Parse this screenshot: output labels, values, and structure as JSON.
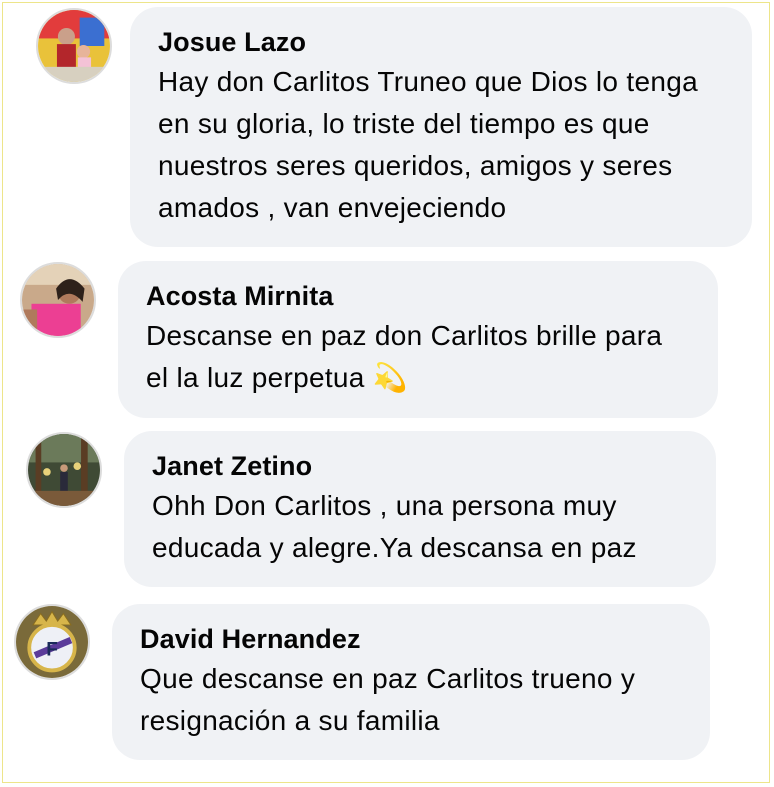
{
  "colors": {
    "bubble": "#f0f2f5",
    "text": "#050505",
    "frame": "#ede58a"
  },
  "comments": [
    {
      "author": "Josue Lazo",
      "text": "Hay don Carlitos Truneo que Dios lo tenga en su gloria, lo triste del tiempo es que nuestros seres queridos, amigos y seres amados , van envejeciendo",
      "avatar_icon": "profile-photo"
    },
    {
      "author": "Acosta Mirnita",
      "text": "Descanse en paz don Carlitos    brille para el la luz perpetua 💫",
      "avatar_icon": "profile-photo"
    },
    {
      "author": "Janet Zetino",
      "text": "Ohh Don Carlitos , una persona muy educada y alegre.Ya descansa en paz",
      "avatar_icon": "profile-photo"
    },
    {
      "author": "David Hernandez",
      "text": "Que descanse en paz Carlitos trueno y resignación a su familia",
      "avatar_icon": "real-madrid-crest"
    }
  ]
}
